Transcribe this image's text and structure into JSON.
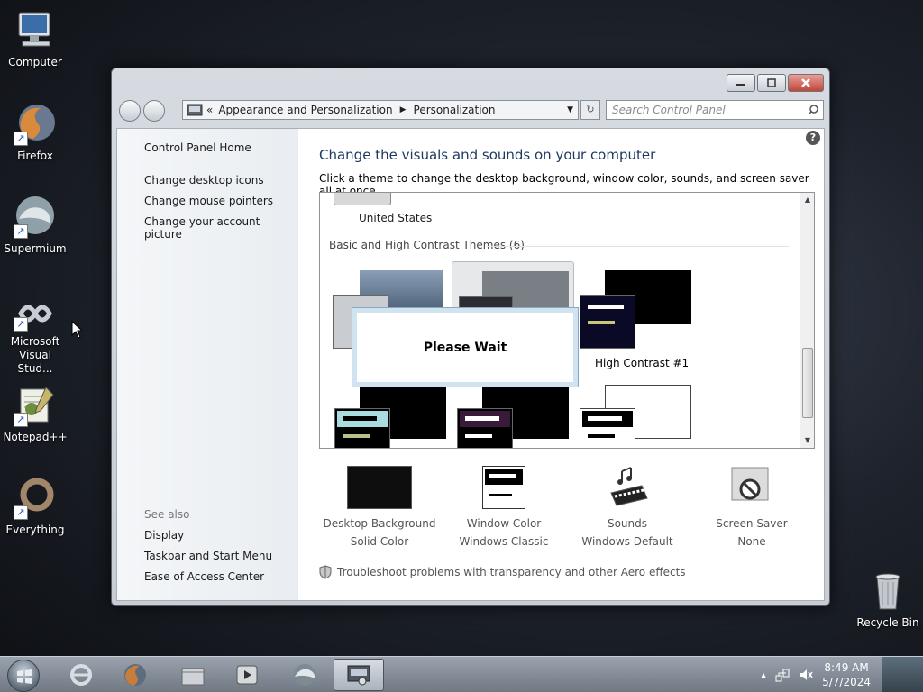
{
  "desktop": {
    "icons": [
      {
        "label": "Computer"
      },
      {
        "label": "Firefox"
      },
      {
        "label": "Supermium"
      },
      {
        "label": "Microsoft Visual Stud..."
      },
      {
        "label": "Notepad++"
      },
      {
        "label": "Everything"
      }
    ],
    "recycle_bin": "Recycle Bin"
  },
  "window": {
    "breadcrumb": {
      "overflow": "«",
      "parent": "Appearance and Personalization",
      "current": "Personalization"
    },
    "search_placeholder": "Search Control Panel",
    "left_pane": {
      "home": "Control Panel Home",
      "links": [
        "Change desktop icons",
        "Change mouse pointers",
        "Change your account picture"
      ],
      "see_also_label": "See also",
      "see_also": [
        "Display",
        "Taskbar and Start Menu",
        "Ease of Access Center"
      ]
    },
    "main": {
      "heading": "Change the visuals and sounds on your computer",
      "subheading": "Click a theme to change the desktop background, window color, sounds, and screen saver all at once.",
      "partial_theme_label": "United States",
      "group_label": "Basic and High Contrast Themes (6)",
      "theme_label": "High Contrast #1",
      "wait_text": "Please Wait",
      "bottom_items": [
        {
          "title": "Desktop Background",
          "value": "Solid Color",
          "icon": "desktop-background-icon"
        },
        {
          "title": "Window Color",
          "value": "Windows Classic",
          "icon": "window-color-icon"
        },
        {
          "title": "Sounds",
          "value": "Windows Default",
          "icon": "sounds-icon"
        },
        {
          "title": "Screen Saver",
          "value": "None",
          "icon": "screen-saver-icon"
        }
      ],
      "troubleshoot": "Troubleshoot problems with transparency and other Aero effects"
    }
  },
  "taskbar": {
    "time": "8:49 AM",
    "date": "5/7/2024",
    "tray_expand": "▲"
  }
}
